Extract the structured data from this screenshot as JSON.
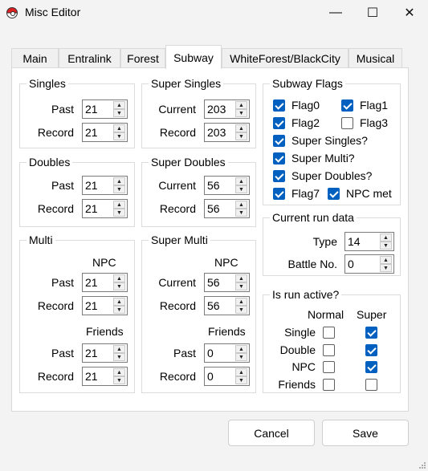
{
  "window": {
    "title": "Misc Editor",
    "minimize_glyph": "—",
    "maximize_glyph": "☐",
    "close_glyph": "✕"
  },
  "tabs": [
    "Main",
    "Entralink",
    "Forest",
    "Subway",
    "WhiteForest/BlackCity",
    "Musical"
  ],
  "active_tab": "Subway",
  "singles": {
    "title": "Singles",
    "past_label": "Past",
    "past": "21",
    "record_label": "Record",
    "record": "21"
  },
  "doubles": {
    "title": "Doubles",
    "past_label": "Past",
    "past": "21",
    "record_label": "Record",
    "record": "21"
  },
  "multi": {
    "title": "Multi",
    "npc_label": "NPC",
    "npc_past_label": "Past",
    "npc_past": "21",
    "npc_record_label": "Record",
    "npc_record": "21",
    "friends_label": "Friends",
    "friends_past_label": "Past",
    "friends_past": "21",
    "friends_record_label": "Record",
    "friends_record": "21"
  },
  "super_singles": {
    "title": "Super Singles",
    "current_label": "Current",
    "current": "203",
    "record_label": "Record",
    "record": "203"
  },
  "super_doubles": {
    "title": "Super Doubles",
    "current_label": "Current",
    "current": "56",
    "record_label": "Record",
    "record": "56"
  },
  "super_multi": {
    "title": "Super Multi",
    "npc_label": "NPC",
    "npc_current_label": "Current",
    "npc_current": "56",
    "npc_record_label": "Record",
    "npc_record": "56",
    "friends_label": "Friends",
    "friends_past_label": "Past",
    "friends_past": "0",
    "friends_record_label": "Record",
    "friends_record": "0"
  },
  "subway_flags": {
    "title": "Subway Flags",
    "flags": [
      {
        "label": "Flag0",
        "checked": true
      },
      {
        "label": "Flag1",
        "checked": true
      },
      {
        "label": "Flag2",
        "checked": true
      },
      {
        "label": "Flag3",
        "checked": false
      },
      {
        "label": "Super Singles?",
        "checked": true
      },
      {
        "label": "Super Multi?",
        "checked": true
      },
      {
        "label": "Super Doubles?",
        "checked": true
      },
      {
        "label": "Flag7",
        "checked": true
      },
      {
        "label": "NPC met",
        "checked": true
      }
    ]
  },
  "current_run": {
    "title": "Current run data",
    "type_label": "Type",
    "type": "14",
    "battle_label": "Battle No.",
    "battle": "0"
  },
  "run_active": {
    "title": "Is run active?",
    "col_normal": "Normal",
    "col_super": "Super",
    "rows": [
      {
        "label": "Single",
        "normal": false,
        "super": true
      },
      {
        "label": "Double",
        "normal": false,
        "super": true
      },
      {
        "label": "NPC",
        "normal": false,
        "super": true
      },
      {
        "label": "Friends",
        "normal": false,
        "super": false
      }
    ]
  },
  "buttons": {
    "cancel": "Cancel",
    "save": "Save"
  },
  "colors": {
    "accent": "#0060c0",
    "background": "#f3f3f3",
    "panel": "#ffffff"
  }
}
